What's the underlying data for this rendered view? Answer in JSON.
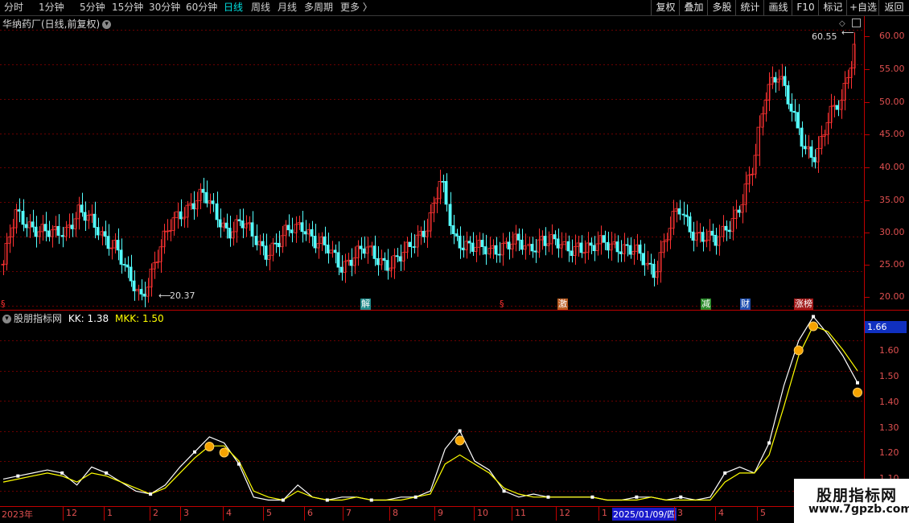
{
  "toolbar": {
    "periods": [
      "分时",
      "1分钟",
      "5分钟",
      "15分钟",
      "30分钟",
      "60分钟",
      "日线",
      "周线",
      "月线",
      "多周期",
      "更多 〉"
    ],
    "active_period": "日线",
    "right_buttons": [
      "复权",
      "叠加",
      "多股",
      "统计",
      "画线",
      "F10",
      "标记",
      "+自选",
      "返回"
    ]
  },
  "main_chart": {
    "title": "华纳药厂(日线,前复权)",
    "high_label": "60.55",
    "low_label": "20.37",
    "y_ticks": [
      "60.00",
      "55.00",
      "50.00",
      "45.00",
      "40.00",
      "35.00",
      "30.00",
      "25.00",
      "20.00"
    ],
    "events": [
      "§",
      "解",
      "§",
      "激",
      "减",
      "财",
      "涨榜"
    ]
  },
  "indicator": {
    "title": "股朋指标网",
    "kk_label": "KK: 1.38",
    "mkk_label": "MKK: 1.50",
    "current_value": "1.66",
    "y_ticks": [
      "1.60",
      "1.50",
      "1.40",
      "1.30",
      "1.20",
      "1.10"
    ]
  },
  "x_axis": {
    "labels": [
      "2023年",
      "12",
      "1",
      "2",
      "3",
      "4",
      "5",
      "6",
      "7",
      "8",
      "9",
      "10",
      "11",
      "12",
      "1",
      "2025/01/09/四",
      "3",
      "4",
      "5"
    ]
  },
  "watermark": {
    "title": "股朋指标网",
    "url": "www.7gpzb.com"
  },
  "chart_data": [
    {
      "type": "candlestick",
      "title": "华纳药厂(日线,前复权)",
      "ylim": [
        19.5,
        62
      ],
      "x_labels": [
        "12",
        "1",
        "2",
        "3",
        "4",
        "5",
        "6",
        "7",
        "8",
        "9",
        "10",
        "11",
        "12",
        "1",
        "2",
        "3",
        "4",
        "5"
      ],
      "close_approx": [
        26,
        33,
        32,
        31,
        30,
        31,
        34,
        32,
        30,
        29,
        24,
        21,
        26,
        30,
        33,
        35,
        36,
        33,
        31,
        32,
        30,
        28,
        29,
        31,
        32,
        29,
        28,
        26,
        27,
        28,
        27,
        26,
        27,
        30,
        32,
        38,
        30,
        29,
        28,
        28,
        29,
        29,
        28,
        30,
        29,
        28,
        29,
        28,
        29,
        29,
        28,
        27,
        25,
        30,
        34,
        31,
        30,
        29,
        32,
        35,
        40,
        52,
        54,
        48,
        43,
        42,
        47,
        50,
        58
      ]
    },
    {
      "type": "line",
      "title": "股朋指标网",
      "ylim": [
        1.05,
        1.7
      ],
      "series": [
        {
          "name": "KK",
          "color": "#ffffff",
          "values": [
            1.14,
            1.15,
            1.16,
            1.17,
            1.16,
            1.12,
            1.18,
            1.16,
            1.13,
            1.1,
            1.09,
            1.12,
            1.18,
            1.23,
            1.28,
            1.26,
            1.19,
            1.08,
            1.07,
            1.07,
            1.12,
            1.08,
            1.07,
            1.08,
            1.08,
            1.07,
            1.07,
            1.08,
            1.08,
            1.1,
            1.24,
            1.3,
            1.2,
            1.17,
            1.1,
            1.08,
            1.09,
            1.08,
            1.08,
            1.08,
            1.08,
            1.07,
            1.07,
            1.08,
            1.08,
            1.07,
            1.08,
            1.07,
            1.08,
            1.16,
            1.18,
            1.16,
            1.26,
            1.45,
            1.6,
            1.68,
            1.62,
            1.55,
            1.46
          ]
        },
        {
          "name": "MKK",
          "color": "#ffff00",
          "values": [
            1.13,
            1.14,
            1.15,
            1.16,
            1.15,
            1.13,
            1.16,
            1.15,
            1.13,
            1.11,
            1.09,
            1.11,
            1.16,
            1.21,
            1.25,
            1.25,
            1.2,
            1.1,
            1.08,
            1.07,
            1.1,
            1.08,
            1.07,
            1.07,
            1.08,
            1.07,
            1.07,
            1.07,
            1.08,
            1.09,
            1.19,
            1.22,
            1.19,
            1.16,
            1.11,
            1.09,
            1.08,
            1.08,
            1.08,
            1.08,
            1.08,
            1.07,
            1.07,
            1.07,
            1.08,
            1.07,
            1.07,
            1.07,
            1.07,
            1.13,
            1.16,
            1.16,
            1.22,
            1.38,
            1.55,
            1.65,
            1.63,
            1.57,
            1.5
          ]
        }
      ]
    }
  ]
}
